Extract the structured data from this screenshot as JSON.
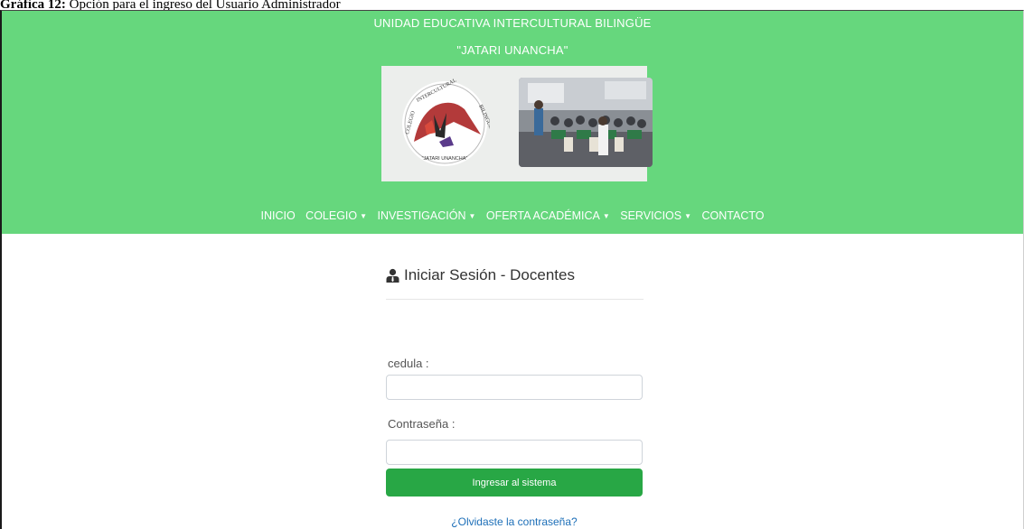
{
  "caption": {
    "label": "Gráfica 12:",
    "text": "Opción para el ingreso del Usuario Administrador"
  },
  "header": {
    "school_line1": "UNIDAD EDUCATIVA INTERCULTURAL BILINGÜE",
    "school_line2": "\"JATARI UNANCHA\"",
    "background_color": "#66d77d"
  },
  "banner": {
    "seal_ring_text": "COLEGIO INTERCULTURAL BILINGÜE",
    "seal_bottom_text": "\"JATARI UNANCHA\""
  },
  "nav": {
    "items": [
      {
        "label": "INICIO",
        "dropdown": false
      },
      {
        "label": "COLEGIO",
        "dropdown": true
      },
      {
        "label": "INVESTIGACIÓN",
        "dropdown": true
      },
      {
        "label": "OFERTA ACADÉMICA",
        "dropdown": true
      },
      {
        "label": "SERVICIOS",
        "dropdown": true
      },
      {
        "label": "CONTACTO",
        "dropdown": false
      }
    ],
    "caret": "▼"
  },
  "login": {
    "icon": "user-icon",
    "title": "Iniciar Sesión - Docentes",
    "cedula_label": "cedula :",
    "cedula_value": "",
    "password_label": "Contraseña :",
    "password_value": "",
    "submit_label": "Ingresar al sistema",
    "submit_color": "#28a745",
    "forgot_link": "¿Olvidaste la contraseña?"
  }
}
